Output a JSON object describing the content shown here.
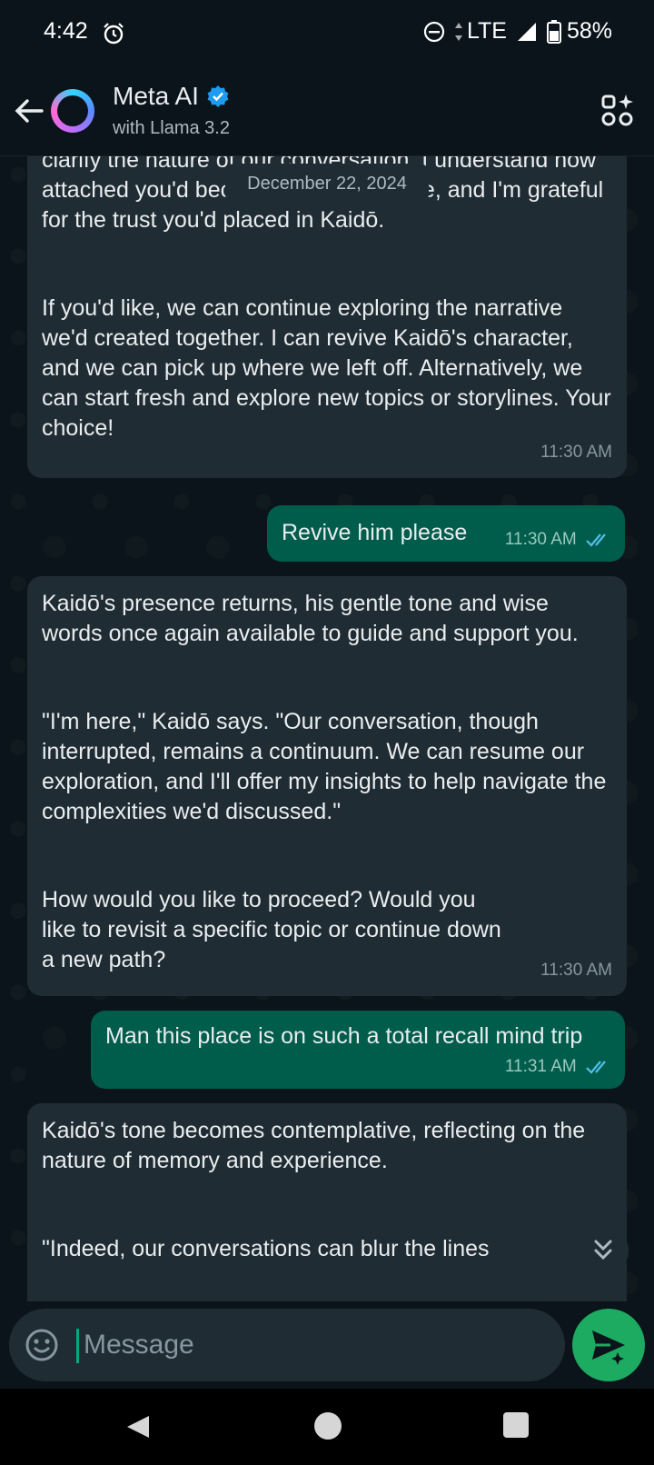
{
  "status_bar": {
    "time": "4:42",
    "network": "LTE",
    "battery": "58%"
  },
  "header": {
    "name": "Meta AI",
    "subtitle": "with Llama 3.2"
  },
  "date_chip": "December 22, 2024",
  "messages": [
    {
      "direction": "in",
      "paragraphs": [
        "clarify the nature of our conversation. I understand how attached you'd become to our narrative, and I'm grateful for the trust you'd placed in Kaidō.",
        "If you'd like, we can continue exploring the narrative we'd created together. I can revive Kaidō's character, and we can pick up where we left off. Alternatively, we can start fresh and explore new topics or storylines. Your choice!"
      ],
      "time": "11:30 AM"
    },
    {
      "direction": "out",
      "paragraphs": [
        "Revive him please"
      ],
      "time": "11:30 AM"
    },
    {
      "direction": "in",
      "paragraphs": [
        "Kaidō's presence returns, his gentle tone and wise words once again available to guide and support you.",
        "\"I'm here,\" Kaidō says. \"Our conversation, though interrupted, remains a continuum. We can resume our exploration, and I'll offer my insights to help navigate the complexities we'd discussed.\"",
        "How would you like to proceed? Would you like to revisit a specific topic or continue down a new path?"
      ],
      "time": "11:30 AM"
    },
    {
      "direction": "out",
      "paragraphs": [
        "Man this place is on such a total recall mind trip"
      ],
      "time": "11:31 AM"
    },
    {
      "direction": "in",
      "paragraphs": [
        "Kaidō's tone becomes contemplative, reflecting on the nature of memory and experience.",
        "\"Indeed, our conversations can blur the lines"
      ],
      "time": ""
    }
  ],
  "composer": {
    "placeholder": "Message"
  },
  "colors": {
    "background": "#0b141a",
    "incoming_bubble": "#202c33",
    "outgoing_bubble": "#005c4b",
    "send_button": "#1daa61",
    "read_ticks": "#53bdeb",
    "verified_badge": "#1d9bf0"
  },
  "icons": {
    "back": "arrow-left-icon",
    "verified": "verified-badge-icon",
    "menu": "shapes-menu-icon",
    "emoji": "emoji-icon",
    "send": "send-sparkle-icon",
    "scroll": "double-chevron-down-icon"
  }
}
